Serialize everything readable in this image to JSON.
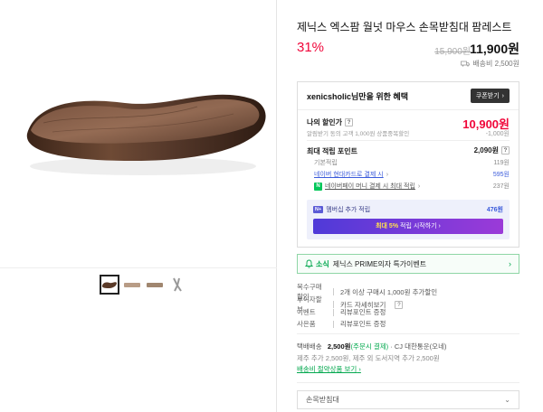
{
  "product": {
    "title": "제닉스 엑스팜 월넛 마우스 손목받침대 팜레스트",
    "discount": "31%",
    "original_price": "15,900원",
    "sale_price": "11,900원",
    "shipping_fee": "배송비 2,500원"
  },
  "benefit": {
    "header": "xenicsholic님만을 위한 혜택",
    "coupon_button": "쿠폰받기",
    "my_discount_label": "나의 할인가",
    "my_discount_sub": "알림받기 동의 고객 1,000원 상품중복할인",
    "my_price": "10,900원",
    "my_discount_amount": "-1,000원",
    "points_label": "최대 적립 포인트",
    "points_total": "2,090원",
    "point_rows": [
      {
        "label": "기본적립",
        "value": "119원"
      },
      {
        "label": "네이버 현대카드로 결제 시",
        "value": "595원"
      },
      {
        "label": "네이버페이 머니 결제 시 최대 적립",
        "value": "237원"
      }
    ],
    "membership_label": "멤버십 추가 적립",
    "membership_value": "476원",
    "membership_button_pre": "최대 5%",
    "membership_button_post": " 적립 시작하기"
  },
  "news": {
    "tag": "소식",
    "text": "제닉스 PRIME의자 특가이벤트"
  },
  "info_rows": [
    {
      "key": "복수구매할인",
      "value": "2개 이상 구매시 1,000원 추가할인"
    },
    {
      "key": "무이자할부",
      "value": "카드 자세히보기"
    },
    {
      "key": "이벤트",
      "value": "리뷰포인트 증정"
    },
    {
      "key": "사은품",
      "value": "리뷰포인트 증정"
    }
  ],
  "shipping": {
    "label": "택배배송",
    "fee": "2,500원",
    "payment": "(주문시 결제)",
    "carrier": "· CJ 대한통운(오네)",
    "extra": "제주 추가 2,500원, 제주 외 도서지역 추가 2,500원",
    "link": "배송비 절약상품 보기"
  },
  "option_select": "손목받침대",
  "colors": {
    "accent": "#f0063a",
    "green": "#03a84e",
    "blue": "#3b5bdb",
    "purple": "#5b3ad8"
  }
}
